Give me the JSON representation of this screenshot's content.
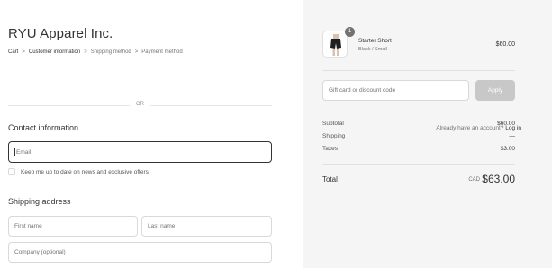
{
  "store": {
    "name": "RYU Apparel Inc."
  },
  "breadcrumb": {
    "items": [
      "Cart",
      "Customer information",
      "Shipping method",
      "Payment method"
    ],
    "separator": ">"
  },
  "divider": {
    "or_text": "OR"
  },
  "contact": {
    "title": "Contact information",
    "login_prompt": "Already have an account?",
    "login_link": "Log in",
    "email_placeholder": "Email",
    "newsletter_label": "Keep me up to date on news and exclusive offers"
  },
  "shipping": {
    "title": "Shipping address",
    "first_name_placeholder": "First name",
    "last_name_placeholder": "Last name",
    "company_placeholder": "Company (optional)"
  },
  "order": {
    "item": {
      "name": "Starter Short",
      "variant": "Black / Small",
      "price": "$60.00",
      "quantity": "1"
    },
    "discount_placeholder": "Gift card or discount code",
    "apply_label": "Apply",
    "subtotal_label": "Subtotal",
    "subtotal_value": "$60.00",
    "shipping_label": "Shipping",
    "shipping_value": "—",
    "taxes_label": "Taxes",
    "taxes_value": "$3.00",
    "total_label": "Total",
    "total_currency": "CAD",
    "total_value": "$63.00"
  },
  "colors": {
    "sidebar_bg": "#f5f5f5",
    "apply_button_bg": "#c8c8c8",
    "badge_bg": "#727272",
    "focused_border": "#333333"
  }
}
